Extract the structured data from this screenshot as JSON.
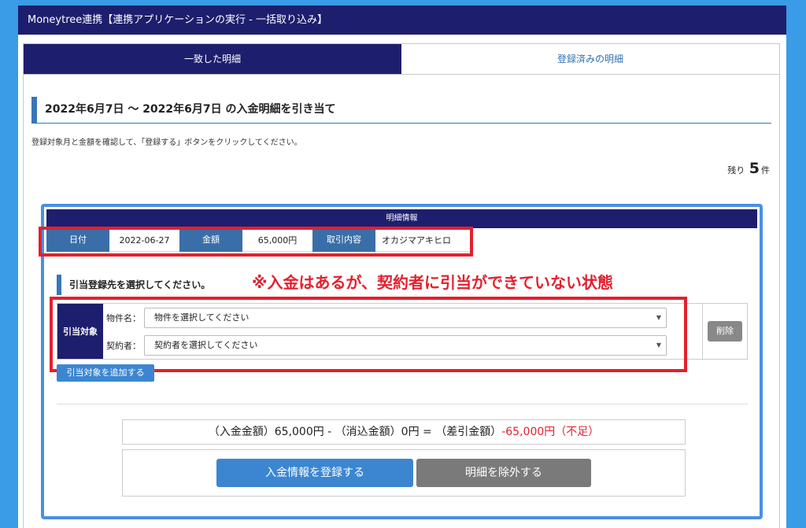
{
  "window": {
    "title": "Moneytree連携【連携アプリケーションの実行 - 一括取り込み】"
  },
  "tabs": [
    {
      "label": "一致した明細",
      "active": true
    },
    {
      "label": "登録済みの明細",
      "active": false
    }
  ],
  "section": {
    "title": "2022年6月7日 〜 2022年6月7日 の入金明細を引き当て",
    "instruction": "登録対象月と金額を確認して、「登録する」ボタンをクリックしてください。"
  },
  "remaining": {
    "prefix": "残り",
    "count": "5",
    "suffix": "件"
  },
  "card": {
    "header": "明細情報",
    "info": {
      "date_label": "日付",
      "date_value": "2022-06-27",
      "amount_label": "金額",
      "amount_value": "65,000円",
      "desc_label": "取引内容",
      "desc_value": "オカジマアキヒロ"
    },
    "select_heading": "引当登録先を選択してください。",
    "annotation": "※入金はあるが、契約者に引当ができていない状態",
    "assign": {
      "label": "引当対象",
      "property_label": "物件名：",
      "property_placeholder": "物件を選択してください",
      "contractor_label": "契約者：",
      "contractor_placeholder": "契約者を選択してください",
      "delete_label": "削除"
    },
    "add_target_label": "引当対象を追加する",
    "summary": {
      "deposit": "（入金金額）65,000円 - （消込金額）0円 = （差引金額）",
      "diff": "-65,000円（不足）"
    },
    "register_label": "入金情報を登録する",
    "exclude_label": "明細を除外する"
  },
  "colors": {
    "navy": "#1e1e6e",
    "accent_blue": "#3677b9",
    "button_blue": "#3c86d1",
    "warning_red": "#e4202e",
    "background": "#3a9be6"
  }
}
